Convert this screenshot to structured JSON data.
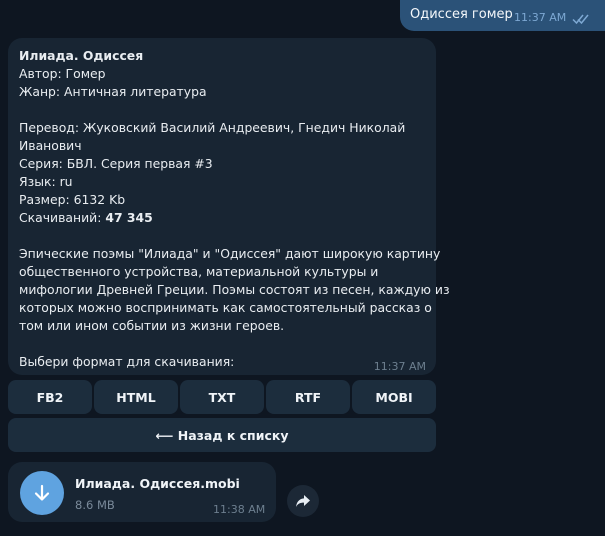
{
  "outgoing": {
    "text": "Одиссея гомер",
    "time": "11:37 AM"
  },
  "book": {
    "title": "Илиада. Одиссея",
    "author": "Автор: Гомер",
    "genre": "Жанр: Античная литература",
    "translation_1": "Перевод: Жуковский Василий Андреевич, Гнедич Николай",
    "translation_2": "Иванович",
    "series": "Серия: БВЛ. Серия первая #3",
    "language": "Язык: ru",
    "size": "Размер: 6132 Kb",
    "downloads_label": "Скачиваний:",
    "downloads_value": "47 345",
    "desc_1": "Эпические поэмы \"Илиада\" и \"Одиссея\" дают широкую картину",
    "desc_2": "общественного устройства, материальной культуры и",
    "desc_3": "мифологии Древней Греции. Поэмы состоят из песен, каждую из",
    "desc_4": "которых можно воспринимать как самостоятельный рассказ о",
    "desc_5": "том или ином событии из жизни героев.",
    "prompt": "Выбери формат для скачивания:",
    "time": "11:37 AM"
  },
  "keyboard": {
    "formats": [
      "FB2",
      "HTML",
      "TXT",
      "RTF",
      "MOBI"
    ],
    "back": "⟵ Назад к списку"
  },
  "file": {
    "name": "Илиада. Одиссея.mobi",
    "size": "8.6 MB",
    "time": "11:38 AM"
  },
  "icons": {
    "read_ticks": "double-check-icon",
    "download": "download-arrow-icon",
    "share": "share-arrow-icon"
  },
  "colors": {
    "background": "#0e1621",
    "outgoing": "#2b5278",
    "incoming": "#182533",
    "button": "#1c2d3d",
    "accent": "#5fa3e0"
  }
}
